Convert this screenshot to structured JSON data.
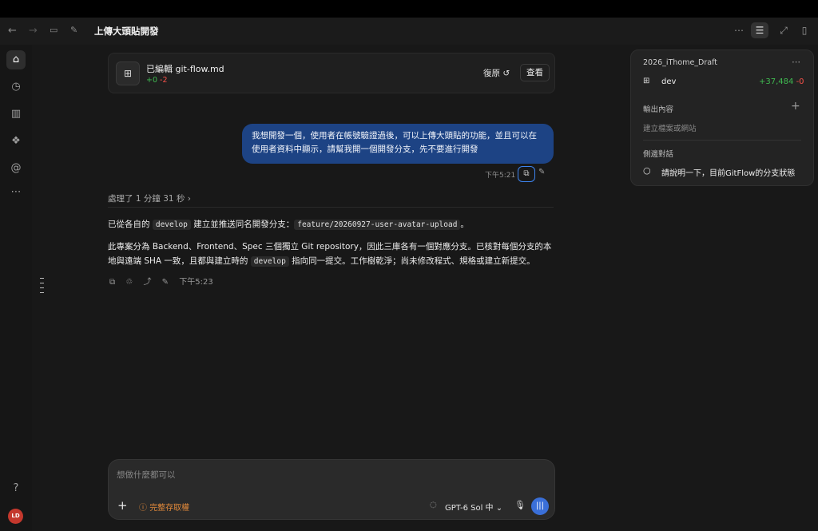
{
  "window": {
    "title": "上傳大頭貼開發"
  },
  "edit_card": {
    "verb": "已編輯",
    "filename": "git-flow.md",
    "added": "+0",
    "removed": "-2",
    "restore_label": "復原",
    "view_label": "查看"
  },
  "user_message": {
    "text": "我想開發一個，使用者在帳號驗證過後，可以上傳大頭貼的功能，並且可以在使用者資料中顯示，請幫我開一個開發分支，先不要進行開發",
    "time": "下午5:21"
  },
  "processed": {
    "text": "處理了 1 分鐘 31 秒"
  },
  "assistant": {
    "p1_a": "已從各自的",
    "p1_code1": "develop",
    "p1_b": "建立並推送同名開發分支：",
    "p1_code2": "feature/20260927-user-avatar-upload",
    "p1_c": "。",
    "p2_a": "此專案分為 Backend、Frontend、Spec 三個獨立 Git repository，因此三庫各有一個對應分支。已核對每個分支的本地與遠端 SHA 一致，且都與建立時的",
    "p2_code": "develop",
    "p2_b": "指向同一提交。工作樹乾淨；尚未修改程式、規格或建立新提交。",
    "time": "下午5:23"
  },
  "composer": {
    "placeholder": "想做什麼都可以",
    "permission_label": "完整存取權",
    "model_label": "GPT-6 Sol 中"
  },
  "side_panel": {
    "title": "2026_iThome_Draft",
    "branch": "dev",
    "branch_added": "+37,484",
    "branch_removed": "-0",
    "output_heading": "輸出內容",
    "output_sub": "建立檔案或網站",
    "side_heading": "側邊對話",
    "side_chat": "請說明一下，目前GitFlow的分支狀態"
  },
  "user": {
    "initials": "LD"
  },
  "colors": {
    "accent": "#3d84f0",
    "bubble": "#1d4384",
    "added": "#3fb950",
    "removed": "#f85149",
    "warning": "#e0883a",
    "avatar": "#c4382d"
  },
  "icons": [
    "back-arrow-icon",
    "forward-arrow-icon",
    "sidebar-toggle-icon",
    "new-chat-icon",
    "home-icon",
    "history-icon",
    "library-icon",
    "plugins-icon",
    "mention-icon",
    "more-icon",
    "help-icon",
    "file-diff-icon",
    "undo-icon",
    "copy-icon",
    "pencil-icon",
    "mic-icon",
    "voice-icon",
    "spinner-icon",
    "warning-icon",
    "plus-icon",
    "chat-bubble-icon"
  ]
}
